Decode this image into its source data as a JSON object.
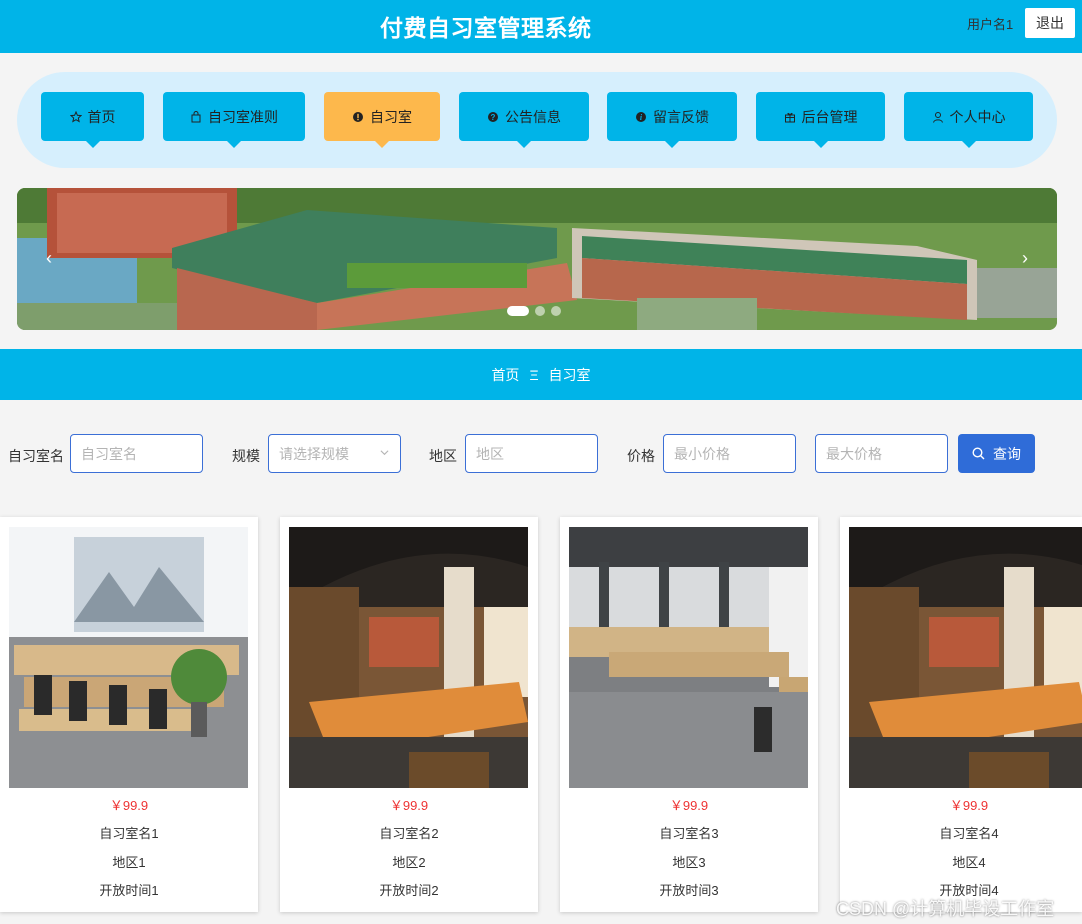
{
  "header": {
    "title": "付费自习室管理系统",
    "username": "用户名1",
    "logout_label": "退出"
  },
  "nav": {
    "items": [
      {
        "label": "首页",
        "icon": "star-icon"
      },
      {
        "label": "自习室准则",
        "icon": "bag-icon"
      },
      {
        "label": "自习室",
        "icon": "alert-circle-icon",
        "active": true
      },
      {
        "label": "公告信息",
        "icon": "question-circle-icon"
      },
      {
        "label": "留言反馈",
        "icon": "info-circle-icon"
      },
      {
        "label": "后台管理",
        "icon": "gift-icon"
      },
      {
        "label": "个人中心",
        "icon": "user-icon"
      }
    ]
  },
  "banner": {
    "prev": "‹",
    "next": "›",
    "slide_count": 3,
    "active_slide": 1
  },
  "breadcrumb": {
    "home": "首页",
    "separator": "Ξ",
    "current": "自习室"
  },
  "filters": {
    "name_label": "自习室名",
    "name_placeholder": "自习室名",
    "scale_label": "规模",
    "scale_placeholder": "请选择规模",
    "region_label": "地区",
    "region_placeholder": "地区",
    "price_label": "价格",
    "min_price_placeholder": "最小价格",
    "max_price_placeholder": "最大价格",
    "search_label": "查询"
  },
  "rooms": [
    {
      "price": "￥99.9",
      "name": "自习室名1",
      "region": "地区1",
      "hours": "开放时间1"
    },
    {
      "price": "￥99.9",
      "name": "自习室名2",
      "region": "地区2",
      "hours": "开放时间2"
    },
    {
      "price": "￥99.9",
      "name": "自习室名3",
      "region": "地区3",
      "hours": "开放时间3"
    },
    {
      "price": "￥99.9",
      "name": "自习室名4",
      "region": "地区4",
      "hours": "开放时间4"
    }
  ],
  "watermark": "CSDN @计算机毕设工作室",
  "colors": {
    "primary": "#00b4e8",
    "active": "#fdb84c",
    "button": "#2f6cd8",
    "price": "#e33333"
  }
}
